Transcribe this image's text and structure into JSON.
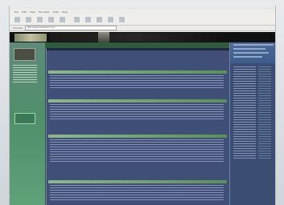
{
  "browser": {
    "menu": [
      "File",
      "Edit",
      "View",
      "Favorites",
      "Tools",
      "Help"
    ],
    "address_label": "Address",
    "address_value": "http://www.evilavatar.com/…"
  },
  "colors": {
    "page_bg": "#2f5a3c",
    "main_panel": "#3f4f77",
    "section_bar": "#8fb88a",
    "right_panel": "#3b4d72"
  },
  "main": {
    "intro": "",
    "sections": [
      {
        "title": ""
      },
      {
        "title": ""
      },
      {
        "title": ""
      },
      {
        "title": ""
      }
    ]
  }
}
